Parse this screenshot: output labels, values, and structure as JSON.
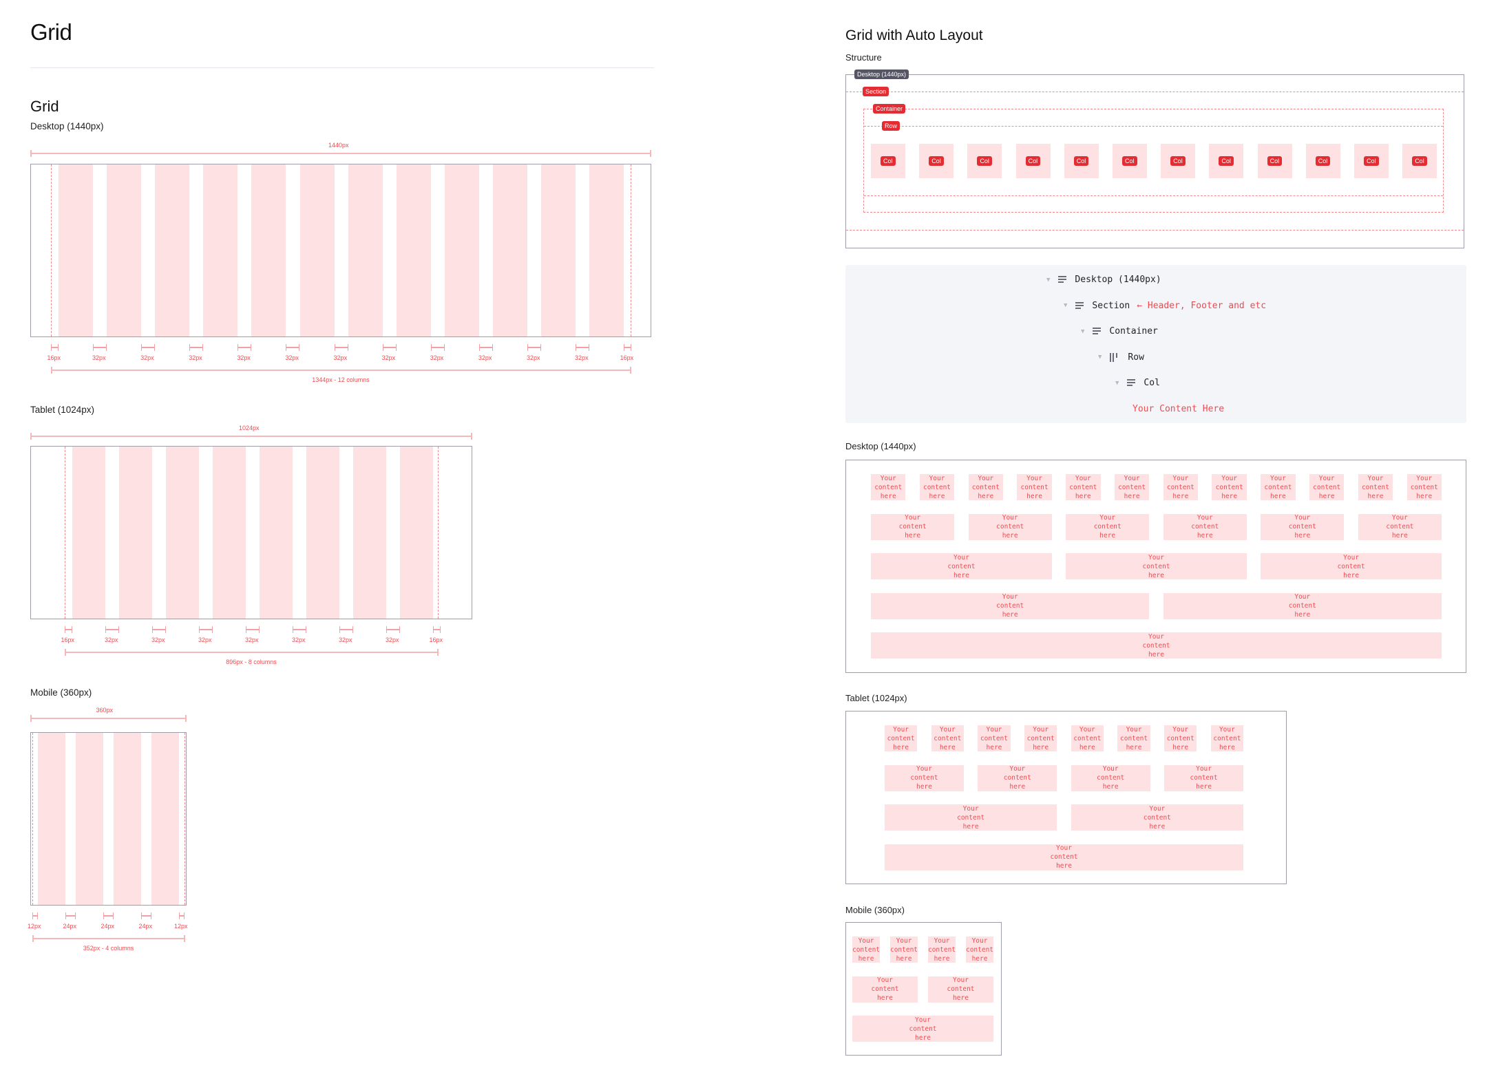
{
  "page_title": "Grid",
  "left": {
    "section_title": "Grid",
    "desktop": {
      "label": "Desktop (1440px)",
      "width_label": "1440px",
      "columns": 12,
      "margin_label": "16px",
      "gutter_label": "32px",
      "total_label": "1344px - 12 columns"
    },
    "tablet": {
      "label": "Tablet (1024px)",
      "width_label": "1024px",
      "columns": 8,
      "margin_label": "16px",
      "gutter_label": "32px",
      "total_label": "896px - 8 columns"
    },
    "mobile": {
      "label": "Mobile (360px)",
      "width_label": "360px",
      "columns": 4,
      "margin_label": "12px",
      "gutter_label": "24px",
      "total_label": "352px - 4 columns"
    }
  },
  "right": {
    "section_title": "Grid with Auto Layout",
    "structure_label": "Structure",
    "structure": {
      "desktop_tag": "Desktop (1440px)",
      "section_tag": "Section",
      "container_tag": "Container",
      "row_tag": "Row",
      "col_tag": "Col",
      "col_count": 12
    },
    "layers": [
      {
        "name": "Desktop (1440px)",
        "icon": "align-left-icon",
        "note": ""
      },
      {
        "name": "Section",
        "icon": "align-left-icon",
        "note": "← Header, Footer and etc"
      },
      {
        "name": "Container",
        "icon": "align-left-icon",
        "note": ""
      },
      {
        "name": "Row",
        "icon": "columns-icon",
        "note": ""
      },
      {
        "name": "Col",
        "icon": "align-left-icon",
        "note": ""
      }
    ],
    "layers_content": "Your Content Here",
    "content_text": "Your\ncontent\nhere",
    "desktop": {
      "label": "Desktop (1440px)",
      "columns": 12,
      "row_spans": [
        1,
        2,
        4,
        6,
        12
      ]
    },
    "tablet": {
      "label": "Tablet (1024px)",
      "columns": 8,
      "row_spans": [
        1,
        2,
        4,
        8
      ]
    },
    "mobile": {
      "label": "Mobile (360px)",
      "columns": 4,
      "row_spans": [
        1,
        2,
        4
      ]
    }
  },
  "colors": {
    "accent_red": "#e32d33",
    "column_fill": "#fee2e3",
    "measure_text": "#ef4b51",
    "frame_border": "#9e9eaa",
    "layers_bg": "#f4f5f8"
  }
}
